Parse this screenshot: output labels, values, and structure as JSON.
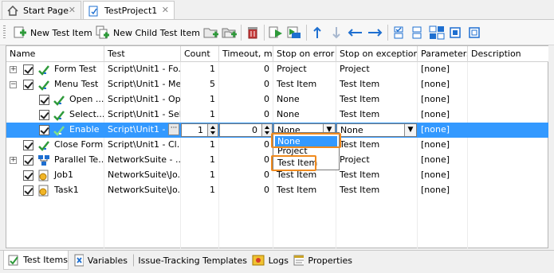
{
  "doc_tabs": [
    {
      "label": "Start Page",
      "icon": "home-icon",
      "active": false
    },
    {
      "label": "TestProject1",
      "icon": "project-icon",
      "active": true
    }
  ],
  "toolbar": {
    "new_test_item": "New Test Item",
    "new_child_test_item": "New Child Test Item"
  },
  "columns": [
    "Name",
    "Test",
    "Count",
    "Timeout, min",
    "Stop on error",
    "Stop on exception",
    "Parameters",
    "Description"
  ],
  "rows": [
    {
      "name": "Form Test",
      "test": "Script\\Unit1 - Fo...",
      "count": "1",
      "timeout": "0",
      "stop_error": "Project",
      "stop_exception": "Project",
      "parameters": "[none]",
      "description": ""
    },
    {
      "name": "Menu Test",
      "test": "Script\\Unit1 - Me...",
      "count": "5",
      "timeout": "0",
      "stop_error": "Test Item",
      "stop_exception": "Test Item",
      "parameters": "[none]",
      "description": ""
    },
    {
      "name": "Open ...",
      "test": "Script\\Unit1 - Op...",
      "count": "1",
      "timeout": "0",
      "stop_error": "None",
      "stop_exception": "Test Item",
      "parameters": "[none]",
      "description": ""
    },
    {
      "name": "Select...",
      "test": "Script\\Unit1 - Sel...",
      "count": "1",
      "timeout": "0",
      "stop_error": "None",
      "stop_exception": "Test Item",
      "parameters": "[none]",
      "description": ""
    },
    {
      "name": "Enable",
      "test": "Script\\Unit1 - ...",
      "count": "1",
      "timeout": "0",
      "stop_error": "None",
      "stop_exception": "None",
      "parameters": "[none]",
      "description": ""
    },
    {
      "name": "Close Form",
      "test": "Script\\Unit1 - Cl...",
      "count": "1",
      "timeout": "0",
      "stop_error": "",
      "stop_exception": "Test Item",
      "parameters": "[none]",
      "description": ""
    },
    {
      "name": "Parallel Te...",
      "test": "NetworkSuite - ...",
      "count": "1",
      "timeout": "0",
      "stop_error": "",
      "stop_exception": "Project",
      "parameters": "[none]",
      "description": ""
    },
    {
      "name": "Job1",
      "test": "NetworkSuite\\Jo...",
      "count": "1",
      "timeout": "0",
      "stop_error": "Test Item",
      "stop_exception": "Test Item",
      "parameters": "[none]",
      "description": ""
    },
    {
      "name": "Task1",
      "test": "NetworkSuite\\Jo...",
      "count": "1",
      "timeout": "0",
      "stop_error": "Test Item",
      "stop_exception": "Test Item",
      "parameters": "[none]",
      "description": ""
    }
  ],
  "dropdown": {
    "options": [
      "None",
      "Project",
      "Test Item"
    ],
    "highlighted": "None"
  },
  "bottom_tabs": [
    {
      "label": "Test Items",
      "icon": "test-items-icon",
      "active": true
    },
    {
      "label": "Variables",
      "icon": "variables-icon",
      "active": false
    },
    {
      "label": "Issue-Tracking Templates",
      "icon": "issue-tracking-icon",
      "active": false
    },
    {
      "label": "Logs",
      "icon": "logs-icon",
      "active": false
    },
    {
      "label": "Properties",
      "icon": "properties-icon",
      "active": false
    }
  ],
  "colors": {
    "selection": "#3399ff",
    "highlight_box": "#f08a1e",
    "icon_green": "#2e9a3a",
    "icon_blue": "#1e6fd0"
  }
}
